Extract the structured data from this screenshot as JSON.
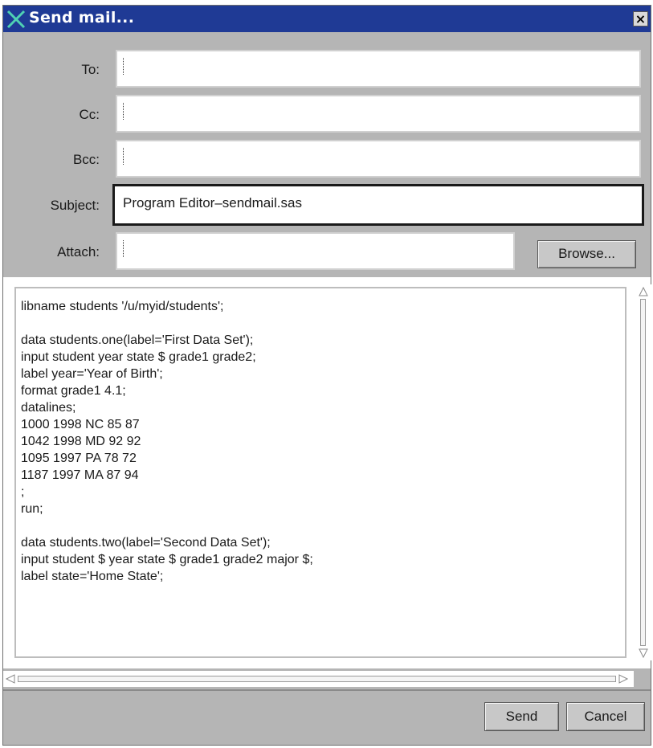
{
  "window": {
    "title": "Send mail...",
    "close_glyph": "×"
  },
  "form": {
    "to": {
      "label": "To:",
      "value": ""
    },
    "cc": {
      "label": "Cc:",
      "value": ""
    },
    "bcc": {
      "label": "Bcc:",
      "value": ""
    },
    "subject": {
      "label": "Subject:",
      "value": "Program Editor–sendmail.sas"
    },
    "attach": {
      "label": "Attach:",
      "value": "",
      "browse_label": "Browse..."
    }
  },
  "editor": {
    "lines": [
      "libname students '/u/myid/students';",
      "",
      "data students.one(label='First Data Set');",
      "input student year state $ grade1 grade2;",
      "label year='Year of Birth';",
      "format grade1 4.1;",
      "datalines;",
      "1000 1998 NC 85 87",
      "1042 1998 MD 92 92",
      "1095 1997 PA 78 72",
      "1187 1997 MA 87 94",
      ";",
      "run;",
      "",
      "data students.two(label='Second Data Set');",
      "input student $ year state $ grade1 grade2 major $;",
      "label state='Home State';"
    ]
  },
  "footer": {
    "send_label": "Send",
    "cancel_label": "Cancel"
  },
  "icons": {
    "title_logo": "x-logo-icon",
    "close": "close-icon",
    "scroll_up": "arrow-up-icon",
    "scroll_down": "arrow-down-icon",
    "scroll_left": "arrow-left-icon",
    "scroll_right": "arrow-right-icon"
  },
  "colors": {
    "titlebar": "#1f3a95",
    "window_bg": "#b5b5b5",
    "logo_green": "#4fd1b3"
  }
}
